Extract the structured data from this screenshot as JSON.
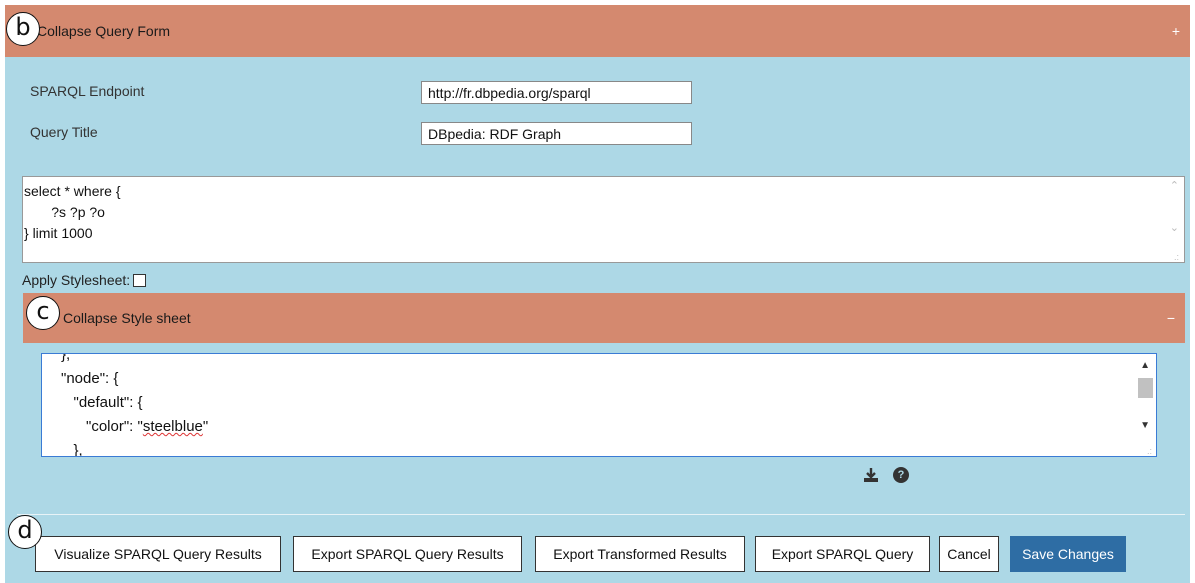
{
  "query_form": {
    "header_title": "Collapse Query Form",
    "toggle_symbol": "+",
    "endpoint_label": "SPARQL Endpoint",
    "endpoint_value": "http://fr.dbpedia.org/sparql",
    "title_label": "Query Title",
    "title_value": "DBpedia: RDF Graph",
    "query_lines": [
      "select * where {",
      "       ?s ?p ?o",
      "} limit 1000"
    ],
    "apply_stylesheet_label": "Apply Stylesheet:",
    "apply_stylesheet_checked": false
  },
  "style_sheet": {
    "header_title": "Collapse Style sheet",
    "toggle_symbol": "−",
    "code_lines": [
      "},",
      "\"node\": {",
      "   \"default\": {",
      "      \"color\": \"steelblue\"",
      "   },"
    ]
  },
  "icons": {
    "download": "download-icon",
    "help": "question-circle-icon"
  },
  "badges": {
    "b": "b",
    "c": "c",
    "d": "d"
  },
  "buttons": {
    "visualize": "Visualize SPARQL Query Results",
    "export_results": "Export SPARQL Query Results",
    "export_transformed": "Export Transformed Results",
    "export_query": "Export SPARQL Query",
    "cancel": "Cancel",
    "save": "Save Changes"
  },
  "colors": {
    "panel_bg": "#add8e6",
    "header_bg": "#d4896f",
    "primary_button": "#2e6da4"
  }
}
